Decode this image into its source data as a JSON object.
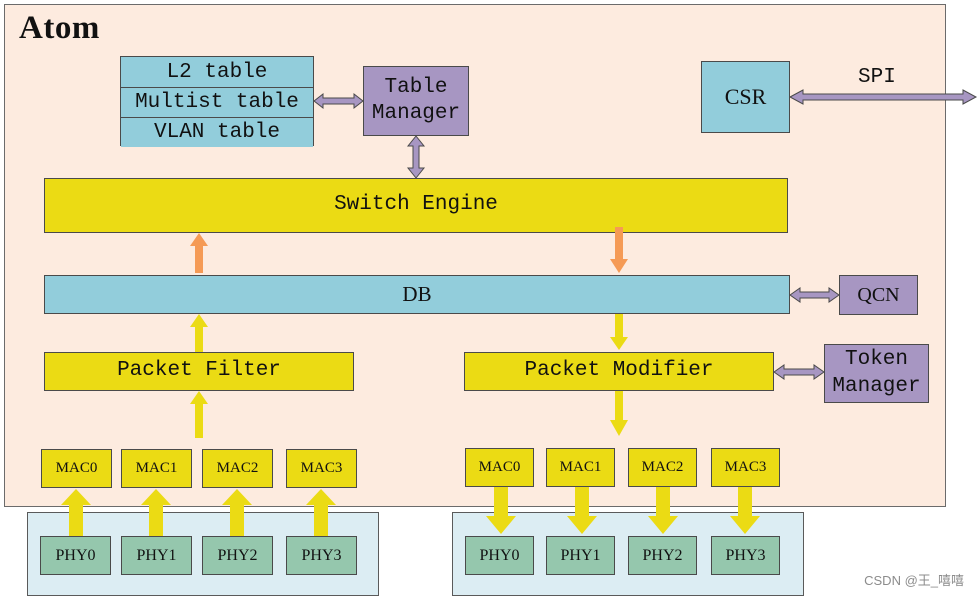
{
  "title": "Atom",
  "tables": [
    "L2 table",
    "Multist table",
    "VLAN table"
  ],
  "blocks": {
    "table_manager": "Table\nManager",
    "csr": "CSR",
    "spi": "SPI",
    "switch_engine": "Switch Engine",
    "db": "DB",
    "qcn": "QCN",
    "packet_filter": "Packet Filter",
    "packet_modifier": "Packet Modifier",
    "token_manager": "Token\nManager"
  },
  "ingress": {
    "macs": [
      "MAC0",
      "MAC1",
      "MAC2",
      "MAC3"
    ],
    "phys": [
      "PHY0",
      "PHY1",
      "PHY2",
      "PHY3"
    ]
  },
  "egress": {
    "macs": [
      "MAC0",
      "MAC1",
      "MAC2",
      "MAC3"
    ],
    "phys": [
      "PHY0",
      "PHY1",
      "PHY2",
      "PHY3"
    ]
  },
  "colors": {
    "container": "#fdebdf",
    "yellow_block": "#ebdb14",
    "cyan_block": "#92cddb",
    "purple_block": "#a796c2",
    "phy_block": "#95c7ad",
    "phy_panel": "#dcedf3",
    "orange_arrow": "#f59a55"
  },
  "watermark": "CSDN @王_嘻嘻"
}
